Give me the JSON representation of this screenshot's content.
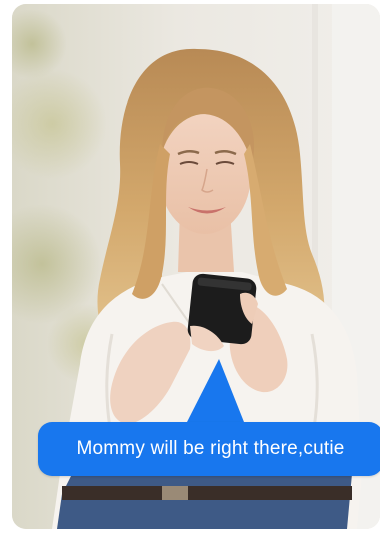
{
  "photo": {
    "subject": "woman-looking-at-phone",
    "colors": {
      "background": "#ece8e2",
      "hair": "#c99a5e",
      "shirt": "#f6f3ef",
      "phone": "#1c1c1c",
      "jeans": "#3e5a86"
    }
  },
  "bubble": {
    "text": "Mommy will be right there,cutie",
    "color": "#1877ee",
    "text_color": "#ffffff"
  }
}
